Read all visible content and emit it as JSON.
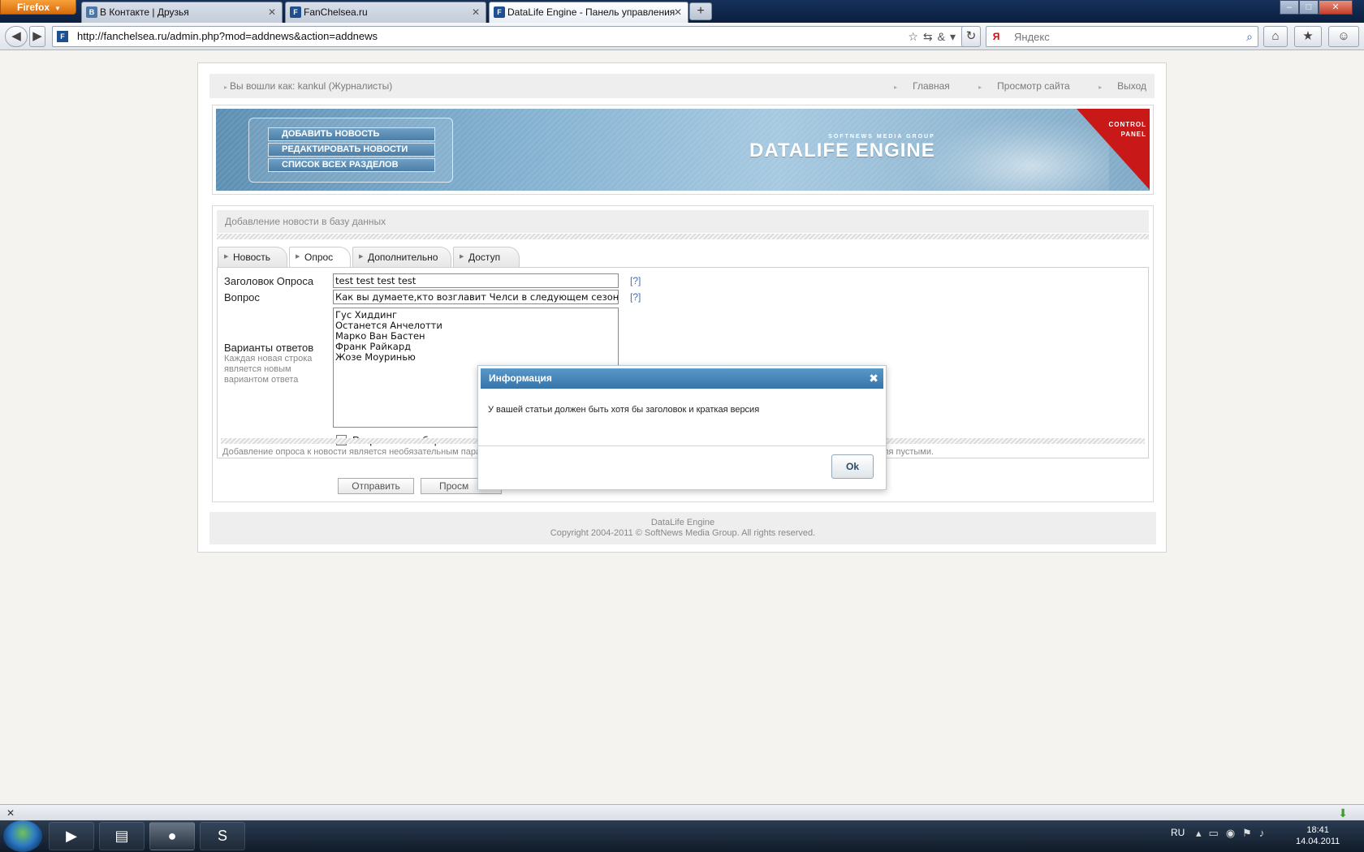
{
  "browser": {
    "menu_label": "Firefox",
    "tabs": [
      {
        "label": "В Контакте | Друзья",
        "icon": "vk-icon"
      },
      {
        "label": "FanChelsea.ru",
        "icon": "chelsea-icon"
      },
      {
        "label": "DataLife Engine - Панель управления",
        "icon": "chelsea-icon"
      }
    ],
    "url": "http://fanchelsea.ru/admin.php?mod=addnews&action=addnews",
    "search_placeholder": "Яндекс"
  },
  "page": {
    "logged_in": "Вы вошли как: kankul (Журналисты)",
    "top_links": [
      "Главная",
      "Просмотр сайта",
      "Выход"
    ],
    "banner": {
      "menu": [
        "ДОБАВИТЬ НОВОСТЬ",
        "РЕДАКТИРОВАТЬ НОВОСТИ",
        "СПИСОК ВСЕХ РАЗДЕЛОВ"
      ],
      "subtitle": "SOFTNEWS MEDIA GROUP",
      "title": "DATALIFE ENGINE",
      "corner_line1": "CONTROL",
      "corner_line2": "PANEL"
    },
    "section_title": "Добавление новости в базу данных",
    "tabs": [
      "Новость",
      "Опрос",
      "Дополнительно",
      "Доступ"
    ],
    "active_tab": "Опрос",
    "form": {
      "poll_title_label": "Заголовок Опроса",
      "poll_title_value": "test test test test",
      "question_label": "Вопрос",
      "question_value": "Как вы думаете,кто возглавит Челси в следующем сезоне?",
      "help_link": "[?]",
      "answers_label": "Варианты ответов",
      "answers_hint": "Каждая новая строка является новым вариантом ответа",
      "answers": [
        "Гус Хиддинг",
        "Останется Анчелотти",
        "Марко Ван Бастен",
        "Франк Райкард",
        "Жозе Моуринью"
      ],
      "multi_choice_label": "Разрешить выбор неско",
      "note": "Добавление опроса к новости является необязательным пара",
      "note_tail": "ля пустыми."
    },
    "buttons": {
      "submit": "Отправить",
      "preview": "Просм"
    },
    "footer_line1": "DataLife Engine",
    "footer_line2": "Copyright 2004-2011 © SoftNews Media Group. All rights reserved."
  },
  "modal": {
    "title": "Информация",
    "message": "У вашей статьи должен быть хотя бы заголовок и краткая версия",
    "ok_label": "Ok"
  },
  "taskbar": {
    "lang": "RU",
    "time": "18:41",
    "date": "14.04.2011"
  }
}
